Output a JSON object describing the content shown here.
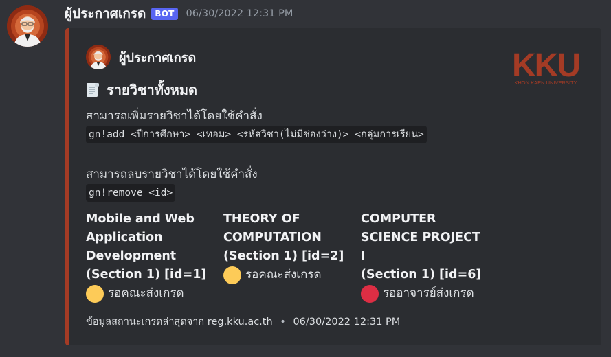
{
  "message": {
    "author": "ผู้ประกาศเกรด",
    "badge": "BOT",
    "timestamp": "06/30/2022 12:31 PM"
  },
  "embed": {
    "accent_color": "#a43b25",
    "author_name": "ผู้ประกาศเกรด",
    "thumbnail": {
      "logo_text": "KKU",
      "caption": "KHON KAEN UNIVERSITY",
      "color": "#a43b25"
    },
    "title_icon": "scroll-icon",
    "title": "รายวิชาทั้งหมด",
    "description": {
      "add_hint": "สามารถเพิ่มรายวิชาได้โดยใช้คำสั่ง",
      "add_command": "gn!add <ปีการศึกษา> <เทอม> <รหัสวิชา(ไม่มีช่องว่าง)> <กลุ่มการเรียน>",
      "remove_hint": "สามารถลบรายวิชาได้โดยใช้คำสั่ง",
      "remove_command": "gn!remove <id>"
    },
    "fields": [
      {
        "name": [
          "Mobile and Web",
          "Application",
          "Development",
          "(Section 1) [id=1]"
        ],
        "status": "รอคณะส่งเกรด",
        "status_color": "#fdcb58"
      },
      {
        "name": [
          "THEORY OF",
          "COMPUTATION",
          "(Section 1) [id=2]"
        ],
        "status": "รอคณะส่งเกรด",
        "status_color": "#fdcb58"
      },
      {
        "name": [
          "COMPUTER",
          "SCIENCE PROJECT",
          "I",
          "(Section 1) [id=6]"
        ],
        "status": "รออาจารย์ส่งเกรด",
        "status_color": "#dd2e44"
      }
    ],
    "footer": {
      "source": "ข้อมูลสถานะเกรดล่าสุดจาก reg.kku.ac.th",
      "separator": "•",
      "timestamp": "06/30/2022 12:31 PM"
    }
  }
}
